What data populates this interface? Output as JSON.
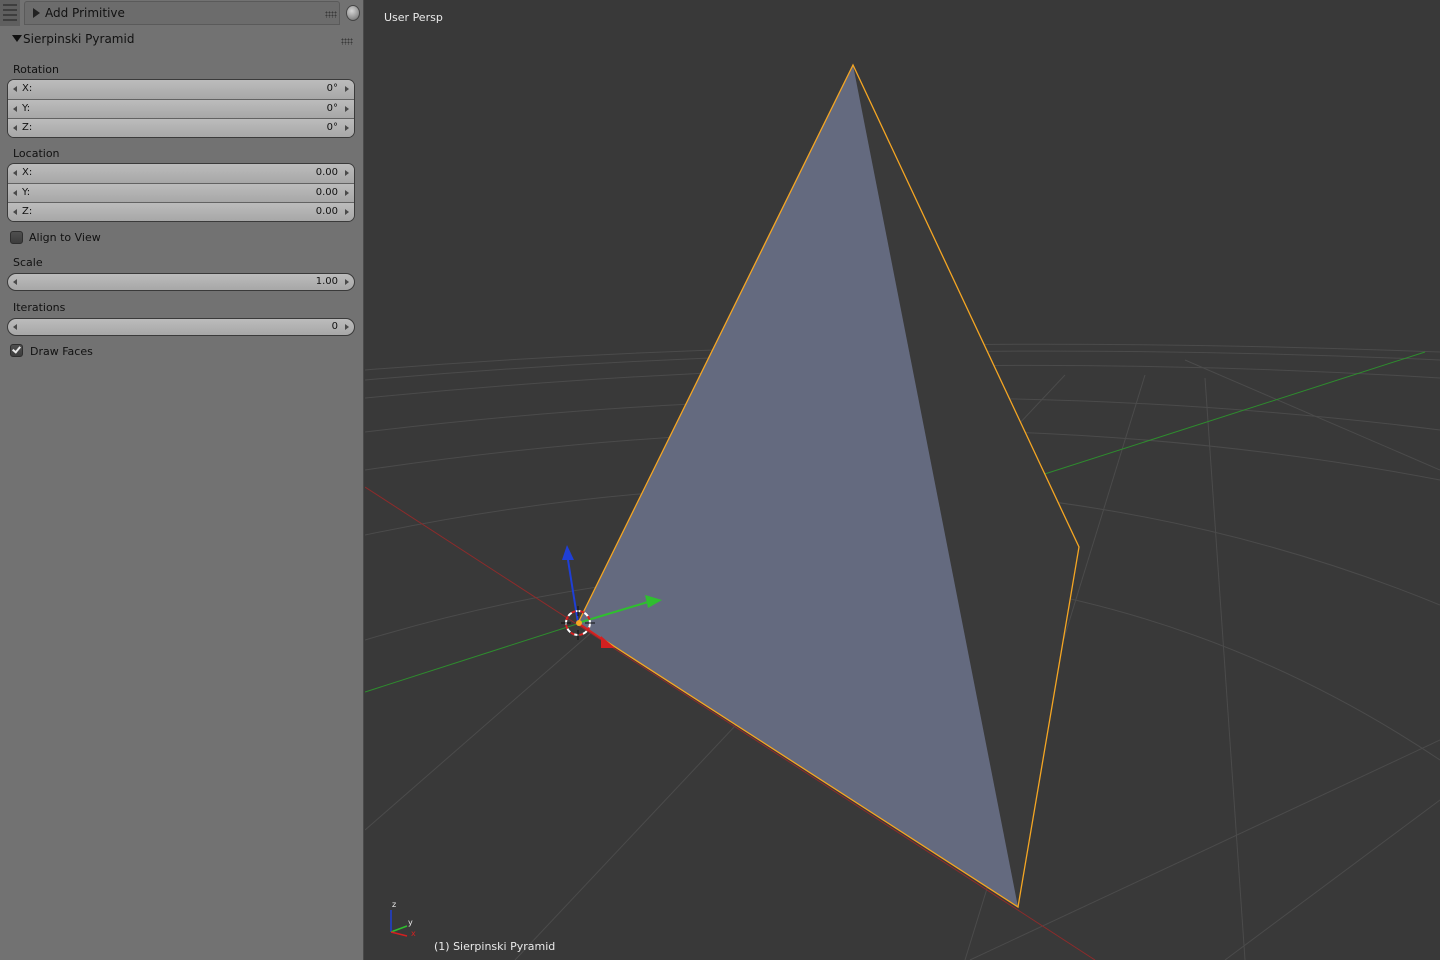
{
  "panel": {
    "header": {
      "title": "Add Primitive"
    },
    "section": {
      "title": "Sierpinski Pyramid"
    },
    "rotation": {
      "label": "Rotation",
      "x": {
        "axis": "X:",
        "value": "0°"
      },
      "y": {
        "axis": "Y:",
        "value": "0°"
      },
      "z": {
        "axis": "Z:",
        "value": "0°"
      }
    },
    "location": {
      "label": "Location",
      "x": {
        "axis": "X:",
        "value": "0.00"
      },
      "y": {
        "axis": "Y:",
        "value": "0.00"
      },
      "z": {
        "axis": "Z:",
        "value": "0.00"
      }
    },
    "align_to_view": {
      "label": "Align to View",
      "checked": false
    },
    "scale": {
      "label": "Scale",
      "value": "1.00"
    },
    "iterations": {
      "label": "Iterations",
      "value": "0"
    },
    "draw_faces": {
      "label": "Draw Faces",
      "checked": true
    }
  },
  "viewport": {
    "view_name": "User Persp",
    "object_info": "(1) Sierpinski Pyramid",
    "axis_labels": {
      "x": "x",
      "y": "y",
      "z": "z"
    },
    "colors": {
      "background": "#393939",
      "face_lit": "#646a7f",
      "face_shadow": "#3a3a3a",
      "selection_outline": "#f5a623",
      "x_axis": "#9b2a2a",
      "y_axis": "#2f8f2f",
      "z_axis": "#1f3fd6",
      "grid": "#4d4d4d"
    }
  }
}
